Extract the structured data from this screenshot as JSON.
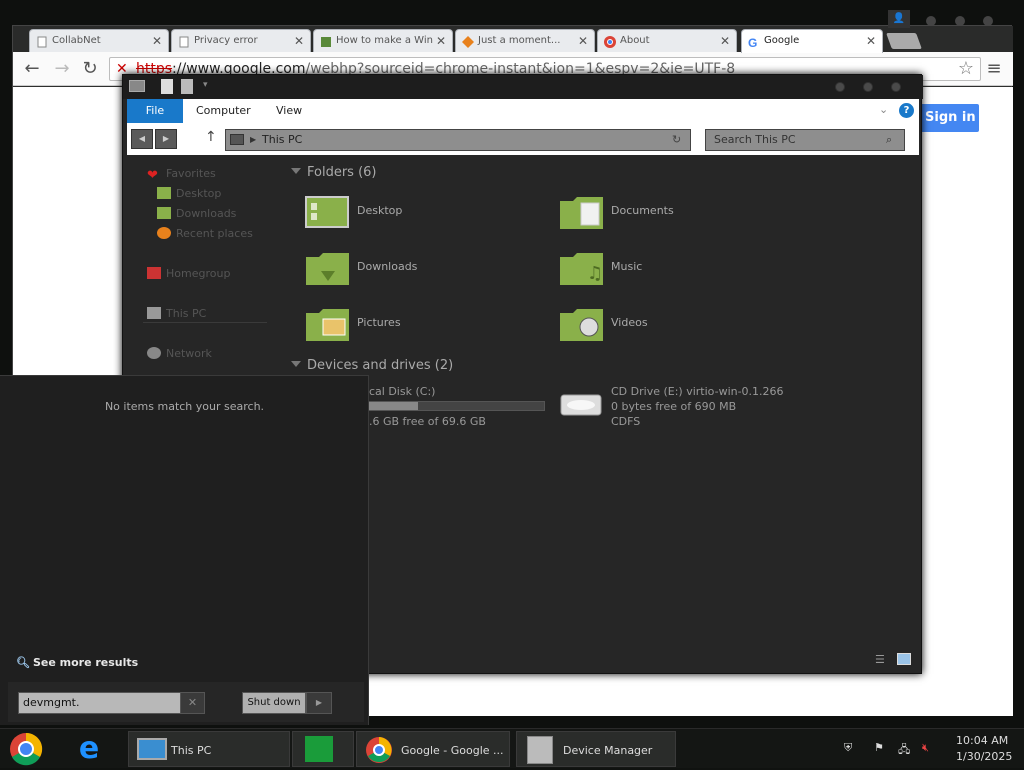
{
  "browser": {
    "tabs": [
      {
        "label": "CollabNet",
        "icon": "page-icon"
      },
      {
        "label": "Privacy error",
        "icon": "page-icon"
      },
      {
        "label": "How to make a Win",
        "icon": "site-icon"
      },
      {
        "label": "Just a moment...",
        "icon": "site-icon"
      },
      {
        "label": "About",
        "icon": "chrome-icon"
      },
      {
        "label": "Google",
        "icon": "google-icon"
      }
    ],
    "url_scheme": "https",
    "url_host": "://www.google.com",
    "url_path": "/webhp?sourceid=chrome-instant&ion=1&espv=2&ie=UTF-8",
    "sign_in_label": "Sign in"
  },
  "explorer": {
    "ribbon": {
      "file": "File",
      "computer": "Computer",
      "view": "View"
    },
    "address": "This PC",
    "search_placeholder": "Search This PC",
    "nav": {
      "favorites": "Favorites",
      "desktop": "Desktop",
      "downloads": "Downloads",
      "recent": "Recent places",
      "homegroup": "Homegroup",
      "this_pc": "This PC",
      "network": "Network"
    },
    "folders_heading": "Folders (6)",
    "folders": [
      {
        "label": "Desktop"
      },
      {
        "label": "Documents"
      },
      {
        "label": "Downloads"
      },
      {
        "label": "Music"
      },
      {
        "label": "Pictures"
      },
      {
        "label": "Videos"
      }
    ],
    "drives_heading": "Devices and drives (2)",
    "drives": {
      "local": {
        "name": "cal Disk (C:)",
        "free": ".6 GB free of 69.6 GB",
        "used_fraction": 0.3
      },
      "cd": {
        "name": "CD Drive (E:) virtio-win-0.1.266",
        "free": "0 bytes free of 690 MB",
        "fs": "CDFS"
      }
    }
  },
  "start": {
    "no_items": "No items match your search.",
    "see_more": "See more results",
    "search_value": "devmgmt.",
    "shutdown": "Shut down"
  },
  "taskbar": {
    "items": [
      {
        "label": "This PC"
      },
      {
        "label": "Google - Google ..."
      },
      {
        "label": "Device Manager"
      }
    ],
    "time": "10:04 AM",
    "date": "1/30/2025"
  },
  "colors": {
    "accent": "#1979ca",
    "folder_green": "#8ab04a",
    "signin_blue": "#4487f2"
  }
}
